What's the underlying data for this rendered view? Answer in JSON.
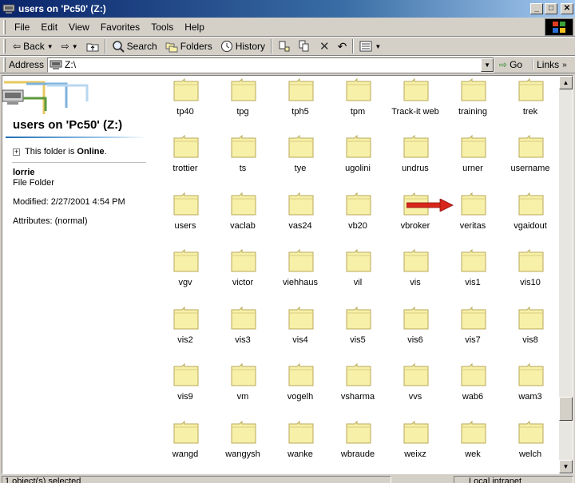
{
  "window": {
    "title": "users on 'Pc50' (Z:)"
  },
  "menu": [
    "File",
    "Edit",
    "View",
    "Favorites",
    "Tools",
    "Help"
  ],
  "toolbar": {
    "back": "Back",
    "search": "Search",
    "folders": "Folders",
    "history": "History"
  },
  "address": {
    "label": "Address",
    "value": "Z:\\",
    "go": "Go",
    "links": "Links"
  },
  "leftpane": {
    "title": "users on 'Pc50' (Z:)",
    "online_prefix": "This folder is ",
    "online_status": "Online",
    "online_suffix": ".",
    "selected_name": "lorrie",
    "selected_type": "File Folder",
    "modified": "Modified: 2/27/2001 4:54 PM",
    "attributes": "Attributes: (normal)"
  },
  "folders": [
    [
      "tp40",
      "tpg",
      "tph5",
      "tpm",
      "Track-it web",
      "training",
      "trek"
    ],
    [
      "trottier",
      "ts",
      "tye",
      "ugolini",
      "undrus",
      "urner",
      "username"
    ],
    [
      "users",
      "vaclab",
      "vas24",
      "vb20",
      "vbroker",
      "veritas",
      "vgaidout"
    ],
    [
      "vgv",
      "victor",
      "viehhaus",
      "vil",
      "vis",
      "vis1",
      "vis10"
    ],
    [
      "vis2",
      "vis3",
      "vis4",
      "vis5",
      "vis6",
      "vis7",
      "vis8"
    ],
    [
      "vis9",
      "vm",
      "vogelh",
      "vsharma",
      "vvs",
      "wab6",
      "wam3"
    ],
    [
      "wangd",
      "wangysh",
      "wanke",
      "wbraude",
      "weixz",
      "wek",
      "welch"
    ]
  ],
  "status": {
    "selection": "1 object(s) selected",
    "zone": "Local intranet"
  },
  "colors": {
    "arrow": "#d9261c",
    "folder": "#f7f0a8",
    "title_bar": "#0a246a"
  }
}
